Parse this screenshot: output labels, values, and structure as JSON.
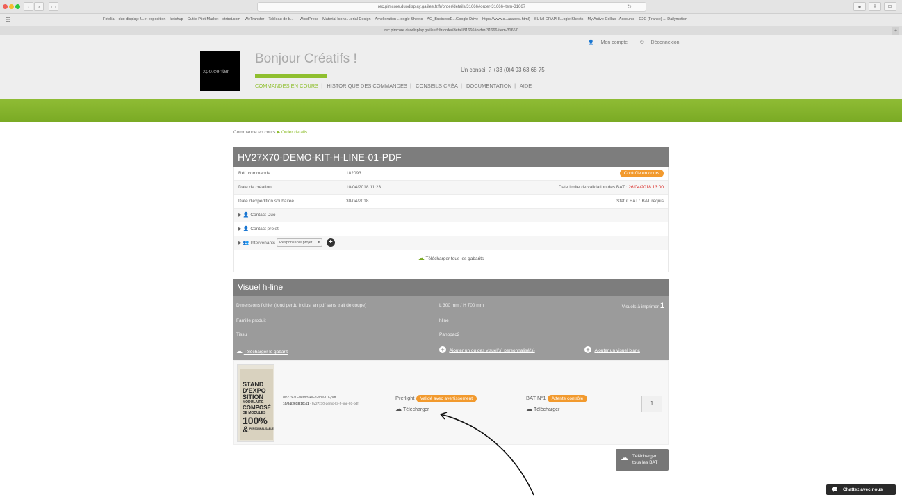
{
  "browser": {
    "url": "rec.pimcore.duodisplay.galilee.fr/fr/order/details/31666#order-31666-item-31667",
    "tab_title": "rec.pimcore.duodisplay.galilee.fr/fr/order/detail/31666#order-31666-item-31667",
    "bookmarks": [
      "Fotolia",
      "duo display: f...et exposition",
      "ketchup",
      "Outils Pilot Market",
      "strbet.com",
      "WeTransfer",
      "Tableau de b... — WordPress",
      "Material Icons...terial Design",
      "Amélioration ...oogle Sheets",
      "AO_BusinessE...Google Drive",
      "https://www.s...arabesl.html)",
      "SUIVI GRAPHI...ogle Sheets",
      "My Active Collab - Accounts",
      "C2C (France) ... Dailymotion"
    ]
  },
  "header": {
    "account_label": "Mon compte",
    "logout_label": "Déconnexion",
    "logo_text": "xpo.center",
    "greeting": "Bonjour Créatifs !",
    "phone": "Un conseil ? +33 (0)4 93 63 68 75",
    "nav": [
      "COMMANDES EN COURS",
      "HISTORIQUE DES COMMANDES",
      "CONSEILS CRÉA",
      "DOCUMENTATION",
      "AIDE"
    ]
  },
  "breadcrumb": {
    "parent": "Commande en cours",
    "current": "Order details"
  },
  "order": {
    "title": "HV27X70-DEMO-KIT-H-LINE-01-PDF",
    "ref_label": "Réf. commande",
    "ref_value": "182093",
    "status_badge": "Contrôle en cours",
    "created_label": "Date de création",
    "created_value": "10/04/2018 11:23",
    "bat_deadline_label": "Date limite de validation des BAT :",
    "bat_deadline_value": "26/04/2018 13:00",
    "shipping_label": "Date d'expédition souhaitée",
    "shipping_value": "30/04/2018",
    "bat_status_label": "Statut BAT :",
    "bat_status_value": "BAT requis",
    "contact_duo": "Contact Duo",
    "contact_project": "Contact projet",
    "intervenants": "Intervenants",
    "role_select": "Responsable projet",
    "download_all_templates": "Télécharger tous les gabarits"
  },
  "visual": {
    "title": "Visuel h-line",
    "dimensions_label": "Dimensions fichier (fond perdu inclus, en pdf sans trait de coupe)",
    "dimensions_value": "L 300 mm / H 700 mm",
    "visuals_to_print_label": "Visuels à imprimer",
    "visuals_to_print_value": "1",
    "family_label": "Famille produit",
    "family_value": "hline",
    "fabric_label": "Tissu",
    "fabric_value": "Panopac2",
    "download_template": "Télécharger le gabarit",
    "add_custom": "Ajouter un ou des visuel(s) personnalisé(s)",
    "add_blank": "Ajouter un visuel blanc"
  },
  "item": {
    "thumb_lines": [
      "STAND",
      "D'EXPO",
      "SITION",
      "MODULAIRE",
      "COMPOSÉ",
      "DE MODULES",
      "100%",
      "&",
      "PERSONNALISABLE"
    ],
    "file_name": "hv27x70-demo-kit-h-line-01-pdf",
    "file_date": "10/04/2018 10:41",
    "file_date_suffix": " - hv27x70-demo-kit-h-line-01-pdf",
    "preflight_label": "Préflight",
    "preflight_badge": "Validé avec avertissement",
    "bat_label": "BAT N°1",
    "bat_badge": "Attente contrôle",
    "download_label": "Télécharger",
    "quantity": "1"
  },
  "actions": {
    "download_all_bat_line1": "Télécharger",
    "download_all_bat_line2": "tous les BAT"
  },
  "chat": {
    "label": "Chattez avec nous"
  },
  "colors": {
    "brand_green": "#8fbf2f",
    "badge_orange": "#f29a2e",
    "panel_gray": "#7d7d7d",
    "deadline_red": "#d8221f"
  }
}
